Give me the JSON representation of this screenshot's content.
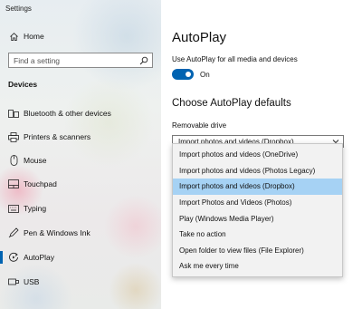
{
  "window": {
    "title": "Settings"
  },
  "sidebar": {
    "home_label": "Home",
    "search_placeholder": "Find a setting",
    "section_header": "Devices",
    "items": [
      {
        "label": "Bluetooth & other devices",
        "icon": "bluetooth-devices-icon"
      },
      {
        "label": "Printers & scanners",
        "icon": "printer-icon"
      },
      {
        "label": "Mouse",
        "icon": "mouse-icon"
      },
      {
        "label": "Touchpad",
        "icon": "touchpad-icon"
      },
      {
        "label": "Typing",
        "icon": "keyboard-icon"
      },
      {
        "label": "Pen & Windows Ink",
        "icon": "pen-icon"
      },
      {
        "label": "AutoPlay",
        "icon": "autoplay-icon",
        "active": true
      },
      {
        "label": "USB",
        "icon": "usb-icon"
      }
    ]
  },
  "main": {
    "title": "AutoPlay",
    "toggle_label": "Use AutoPlay for all media and devices",
    "toggle_state": "On",
    "defaults_title": "Choose AutoPlay defaults",
    "removable_drive_label": "Removable drive",
    "removable_drive_value": "Import photos and videos (Dropbox)",
    "dropdown_options": [
      "Import photos and videos (OneDrive)",
      "Import photos and videos (Photos Legacy)",
      "Import photos and videos (Dropbox)",
      "Import Photos and Videos (Photos)",
      "Play (Windows Media Player)",
      "Take no action",
      "Open folder to view files (File Explorer)",
      "Ask me every time"
    ],
    "selected_option": "Import photos and videos (Dropbox)"
  },
  "colors": {
    "accent": "#0063b1",
    "highlight": "#a6d2f4"
  }
}
